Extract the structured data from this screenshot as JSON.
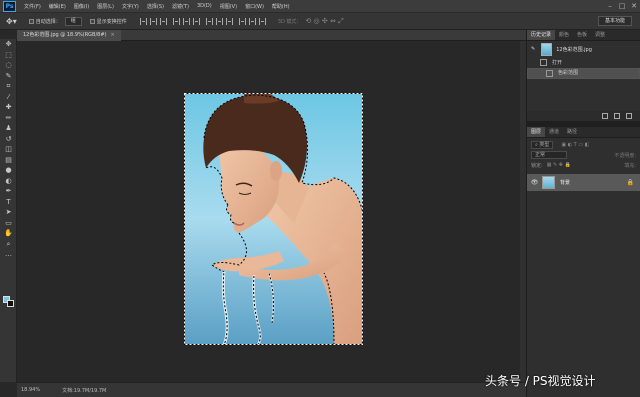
{
  "app": {
    "logo": "Ps"
  },
  "menu": [
    "文件(F)",
    "编辑(E)",
    "图像(I)",
    "图层(L)",
    "文字(Y)",
    "选择(S)",
    "滤镜(T)",
    "3D(D)",
    "视图(V)",
    "窗口(W)",
    "帮助(H)"
  ],
  "window_controls": {
    "minimize": "–",
    "maximize": "□",
    "close": "✕"
  },
  "options_bar": {
    "auto_select_label": "自动选择：",
    "auto_select_value": "组",
    "show_transform_label": "显示变换控件",
    "mode_3d_label": "3D 模式：",
    "workspace": "基本功能"
  },
  "tools": [
    "move-icon",
    "marquee-icon",
    "lasso-icon",
    "quick-select-icon",
    "crop-icon",
    "eyedropper-icon",
    "healing-icon",
    "brush-icon",
    "stamp-icon",
    "history-brush-icon",
    "eraser-icon",
    "gradient-icon",
    "blur-icon",
    "dodge-icon",
    "pen-icon",
    "type-icon",
    "path-select-icon",
    "shape-icon",
    "hand-icon",
    "zoom-icon",
    "more-icon"
  ],
  "tool_glyphs": [
    "✥",
    "⬚",
    "◌",
    "✎",
    "⌗",
    "⁄",
    "✚",
    "✏",
    "♟",
    "↺",
    "◫",
    "▤",
    "●",
    "◐",
    "✒",
    "T",
    "➤",
    "▭",
    "✋",
    "⌕",
    "…"
  ],
  "colors": {
    "foreground": "#7fc3e3",
    "background": "#111111",
    "accent": "#31a8ff"
  },
  "document": {
    "tab_label": "12色彩范围.jpg @ 18.9%(RGB/8#)",
    "close": "×"
  },
  "status": {
    "zoom": "18.94%",
    "doc_size": "文档:19.7M/19.7M"
  },
  "history_panel": {
    "tabs": [
      "历史记录",
      "颜色",
      "色板",
      "调整"
    ],
    "snapshot": "12色彩范围.jpg",
    "items": [
      "打开",
      "色彩范围"
    ]
  },
  "layers_panel": {
    "tabs": [
      "图层",
      "通道",
      "路径"
    ],
    "filter_kind": "类型",
    "blend_mode": "正常",
    "opacity_label": "不透明度:",
    "lock_label": "锁定:",
    "fill_label": "填充:",
    "layers": [
      {
        "name": "背景"
      }
    ]
  },
  "watermark": "头条号 / PS视觉设计"
}
